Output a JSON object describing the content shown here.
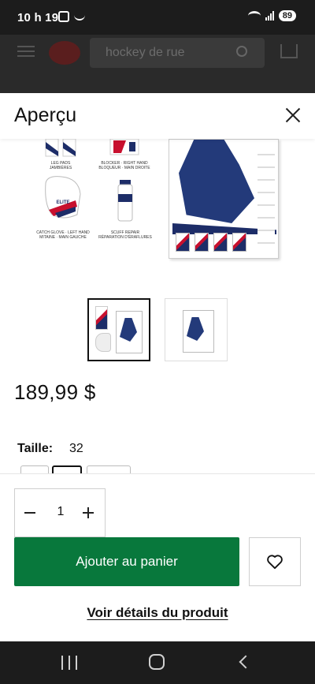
{
  "status_bar": {
    "time": "10 h 19",
    "battery": "89"
  },
  "background_header": {
    "search_placeholder": "hockey de rue"
  },
  "sheet": {
    "title": "Aperçu",
    "product_image_labels": {
      "pads": "LEG PADS\nJAMBIÈRES",
      "blocker": "BLOCKER · RIGHT HAND\nBLOQUEUR · MAIN DROITE",
      "catch_glove": "CATCH GLOVE · LEFT HAND\nMITAINE · MAIN GAUCHE",
      "scuff_repair": "SCUFF REPAIR\nRÉPARATION D'ÉRAFLURES",
      "brand": "ELITE"
    },
    "thumbnails": [
      {
        "label": "image-1",
        "active": true
      },
      {
        "label": "image-2",
        "active": false
      }
    ],
    "price": "189,99 $",
    "size": {
      "label": "Taille:",
      "value": "32"
    },
    "quantity": {
      "value": "1"
    },
    "add_to_cart_label": "Ajouter au panier",
    "details_link_label": "Voir détails du produit"
  },
  "colors": {
    "add_button": "#08783c",
    "text": "#111111",
    "brand_red": "#c8102e",
    "brand_navy": "#1d2d68"
  },
  "icons": {
    "close": "close-icon",
    "minus": "minus-icon",
    "plus": "plus-icon",
    "wishlist": "heart-icon"
  }
}
